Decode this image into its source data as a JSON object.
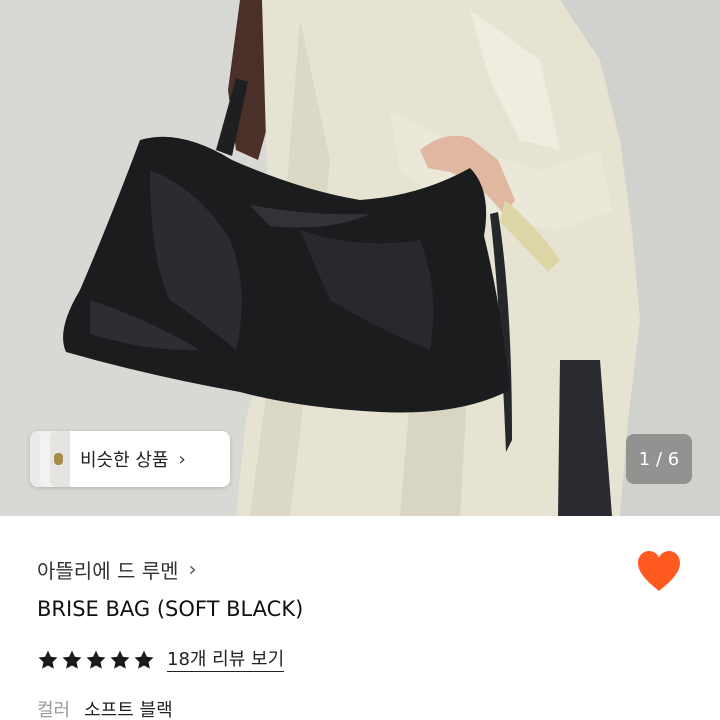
{
  "gallery": {
    "similar_products_label": "비슷한 상품",
    "page_current": 1,
    "page_total": 6,
    "page_indicator": "1 / 6"
  },
  "product": {
    "brand": "아뜰리에 드 루멘",
    "title": "BRISE BAG (SOFT BLACK)",
    "rating_stars": 5,
    "review_link": "18개 리뷰 보기",
    "option_label": "컬러",
    "option_value": "소프트 블랙"
  },
  "icons": {
    "like": "heart-icon",
    "chevron": "chevron-right-icon",
    "star": "star-icon"
  },
  "colors": {
    "heart": "#ff5a1f",
    "star": "#1a1a1a",
    "page_counter_bg": "#5c5c5c"
  }
}
